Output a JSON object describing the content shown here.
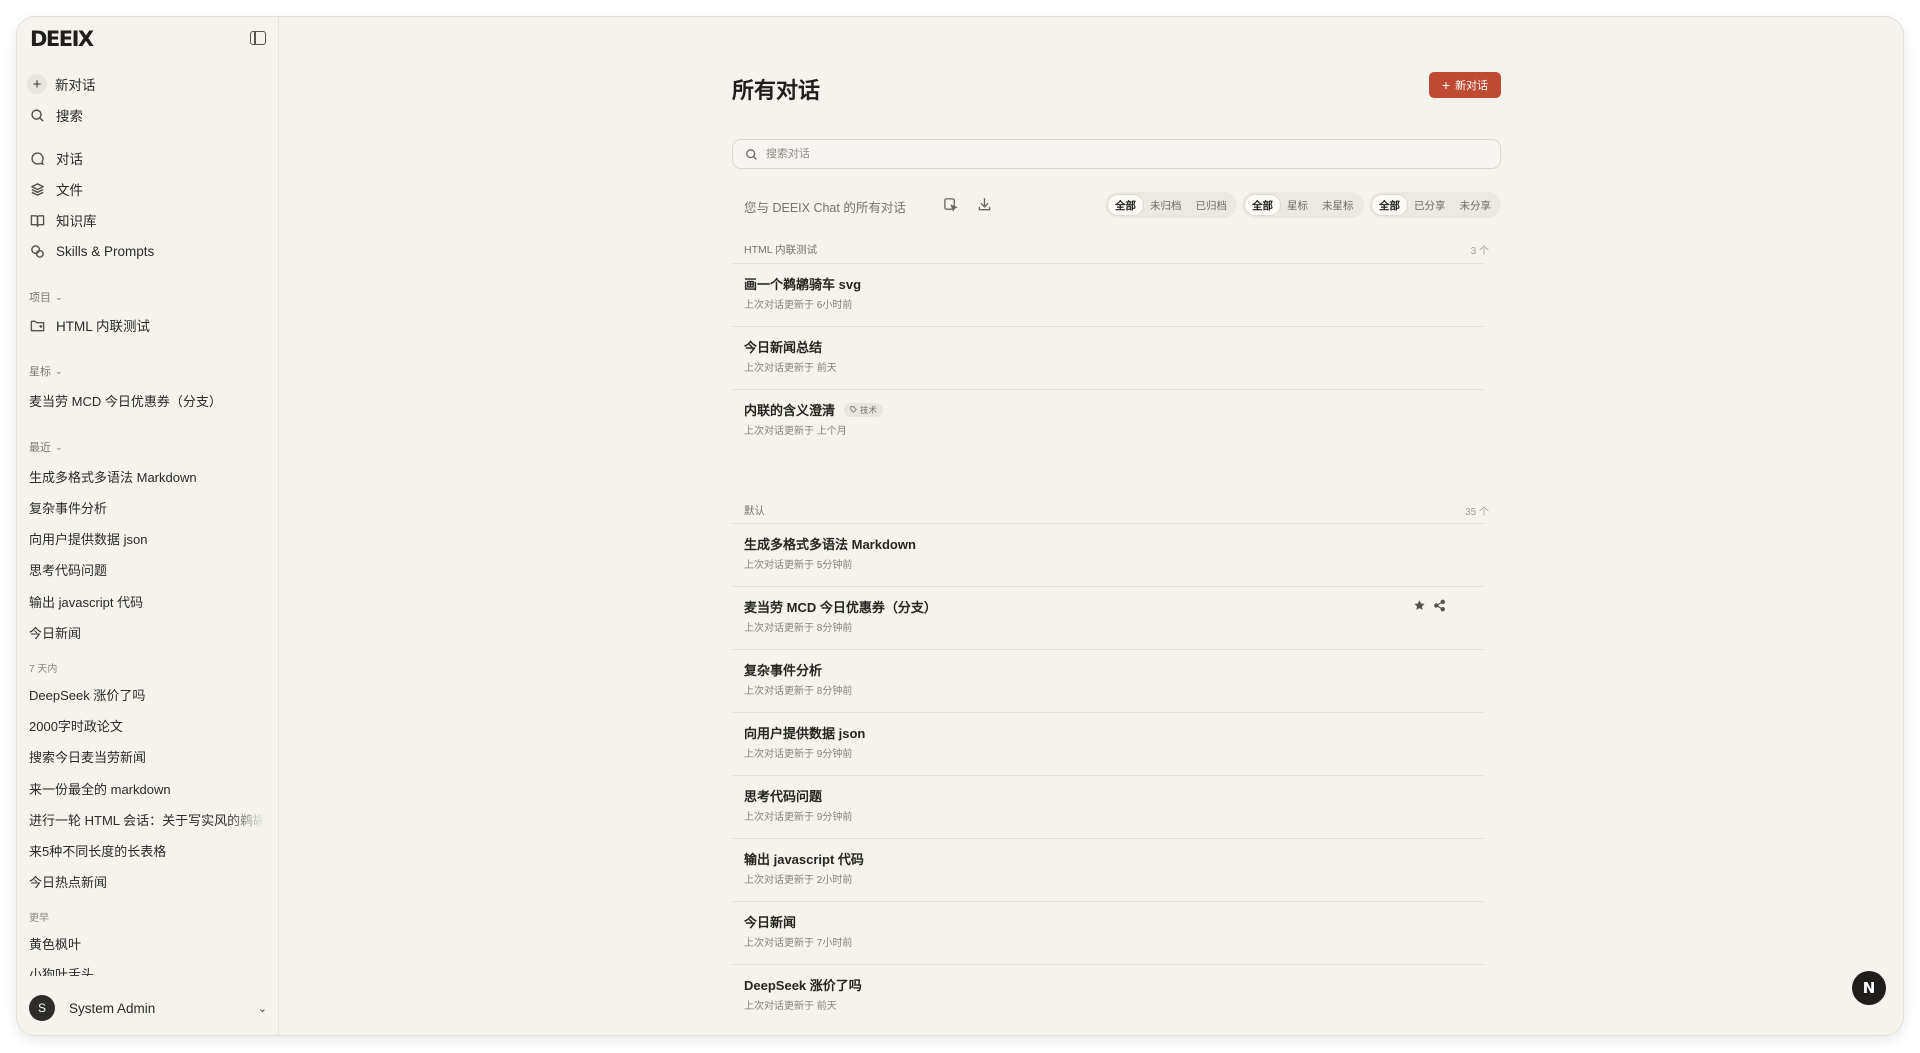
{
  "app": {
    "logo": "DEEIX"
  },
  "sidebar": {
    "new_chat": "新对话",
    "search": "搜索",
    "nav": [
      {
        "label": "对话",
        "icon": "chat-bubble-icon"
      },
      {
        "label": "文件",
        "icon": "layers-icon"
      },
      {
        "label": "知识库",
        "icon": "book-icon"
      },
      {
        "label": "Skills & Prompts",
        "icon": "skills-icon"
      }
    ],
    "projects_label": "项目",
    "projects": [
      "HTML 内联测试"
    ],
    "starred_label": "星标",
    "starred": [
      "麦当劳 MCD 今日优惠券（分支）"
    ],
    "recent_label": "最近",
    "recent": [
      "生成多格式多语法 Markdown",
      "复杂事件分析",
      "向用户提供数据 json",
      "思考代码问题",
      "输出 javascript 代码",
      "今日新闻"
    ],
    "week_label": "7 天内",
    "week": [
      "DeepSeek 涨价了吗",
      "2000字时政论文",
      "搜索今日麦当劳新闻",
      "来一份最全的 markdown",
      "进行一轮 HTML 会话：关于写实风的鹈鹕",
      "来5种不同长度的长表格",
      "今日热点新闻"
    ],
    "earlier_label": "更早",
    "earlier": [
      "黄色枫叶",
      "小狗叶舌头"
    ],
    "user": {
      "initial": "S",
      "name": "System Admin"
    }
  },
  "main": {
    "title": "所有对话",
    "new_chat_button": "新对话",
    "search_placeholder": "搜索对话",
    "subtitle": "您与 DEEIX Chat 的所有对话",
    "filters": {
      "archive": {
        "options": [
          "全部",
          "未归档",
          "已归档"
        ],
        "selected": "全部"
      },
      "star": {
        "options": [
          "全部",
          "星标",
          "未星标"
        ],
        "selected": "全部"
      },
      "share": {
        "options": [
          "全部",
          "已分享",
          "未分享"
        ],
        "selected": "全部"
      }
    },
    "groups": [
      {
        "name": "HTML 内联测试",
        "count": "3 个",
        "items": [
          {
            "title": "画一个鹈鹕骑车 svg",
            "updated": "上次对话更新于 6小时前"
          },
          {
            "title": "今日新闻总结",
            "updated": "上次对话更新于 前天"
          },
          {
            "title": "内联的含义澄清",
            "tag": "技术",
            "updated": "上次对话更新于 上个月"
          }
        ]
      },
      {
        "name": "默认",
        "count": "35 个",
        "items": [
          {
            "title": "生成多格式多语法 Markdown",
            "updated": "上次对话更新于 5分钟前"
          },
          {
            "title": "麦当劳 MCD 今日优惠券（分支）",
            "updated": "上次对话更新于 8分钟前",
            "hover_actions": [
              "star-icon",
              "share-icon"
            ]
          },
          {
            "title": "复杂事件分析",
            "updated": "上次对话更新于 8分钟前"
          },
          {
            "title": "向用户提供数据 json",
            "updated": "上次对话更新于 9分钟前"
          },
          {
            "title": "思考代码问题",
            "updated": "上次对话更新于 9分钟前"
          },
          {
            "title": "输出 javascript 代码",
            "updated": "上次对话更新于 2小时前"
          },
          {
            "title": "今日新闻",
            "updated": "上次对话更新于 7小时前"
          },
          {
            "title": "DeepSeek 涨价了吗",
            "updated": "上次对话更新于 前天"
          }
        ]
      }
    ]
  },
  "help_button": "N",
  "colors": {
    "accent": "#bf4a33",
    "background": "#f4f3ee",
    "text": "#2b2a27"
  }
}
